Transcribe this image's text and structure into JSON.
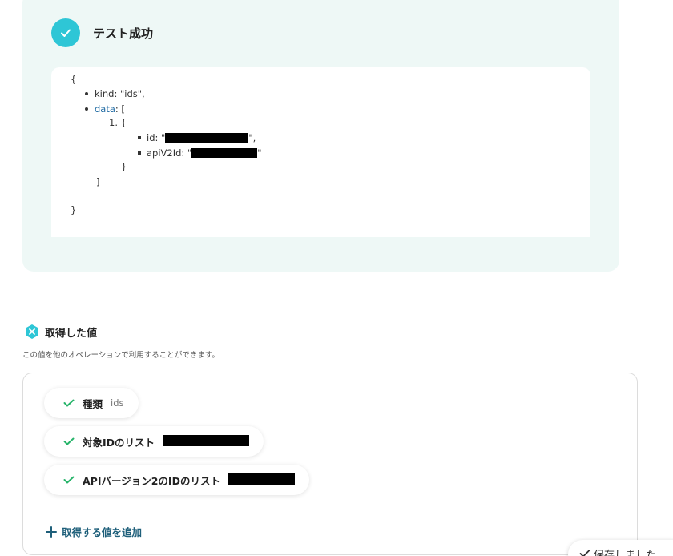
{
  "test_result": {
    "title": "テスト成功",
    "code": {
      "open_brace": "{",
      "kind_line": "kind: \"ids\",",
      "data_key": "data",
      "data_open": ": [",
      "item_open": "1. {",
      "id_prefix": "id: \"",
      "id_suffix": "\",",
      "apiv2_prefix": "apiV2Id: \"",
      "apiv2_suffix": "\"",
      "item_close": "}",
      "array_close": "]",
      "close_brace": "}"
    }
  },
  "obtained_values": {
    "title": "取得した値",
    "description": "この値を他のオペレーションで利用することができます。",
    "items": [
      {
        "label": "種類",
        "value": "ids"
      },
      {
        "label": "対象IDのリスト",
        "value": ""
      },
      {
        "label": "APIバージョン2のIDのリスト",
        "value": ""
      }
    ],
    "add_label": "取得する値を追加"
  },
  "save_status": {
    "label": "保存しました"
  },
  "colors": {
    "accent": "#2ec6d6",
    "check_green": "#27b46a",
    "link": "#1e5f7a"
  },
  "icons": [
    "check-circle-icon",
    "variable-hex-icon",
    "checkmark-icon",
    "plus-icon"
  ]
}
